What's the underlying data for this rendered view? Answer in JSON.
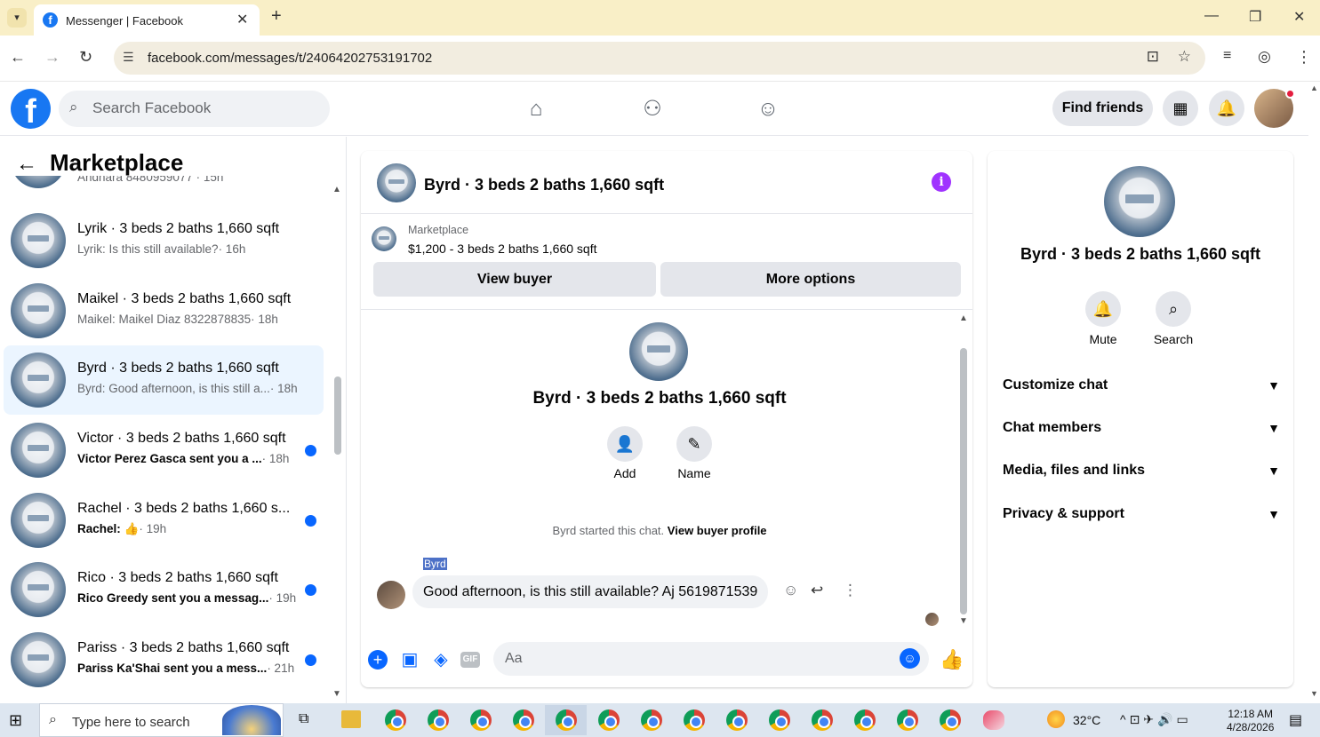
{
  "browser": {
    "tab_title": "Messenger | Facebook",
    "url": "facebook.com/messages/t/24064202753191702",
    "tab_close": "✕",
    "new_tab": "+",
    "window_controls": [
      "—",
      "❐",
      "✕"
    ]
  },
  "header": {
    "logo": "f",
    "search_placeholder": "Search Facebook",
    "find_friends": "Find friends",
    "nav_icons": [
      "home-icon",
      "friends-icon",
      "groups-icon"
    ],
    "right_icons": [
      "menu-grid-icon",
      "bell-icon",
      "avatar"
    ]
  },
  "sidebar": {
    "title": "Marketplace",
    "partial_top": "Andhara 8480959077 · 15h",
    "conversations": [
      {
        "name": "Lyrik · 3 beds 2 baths 1,660 sqft",
        "preview": "Lyrik: Is this still available?",
        "time": "· 16h",
        "unread": false,
        "selected": false
      },
      {
        "name": "Maikel · 3 beds 2 baths 1,660 sqft",
        "preview": "Maikel: Maikel Diaz 8322878835",
        "time": "· 18h",
        "unread": false,
        "selected": false
      },
      {
        "name": "Byrd · 3 beds 2 baths 1,660 sqft",
        "preview": "Byrd: Good afternoon, is this still a...",
        "time": "· 18h",
        "unread": false,
        "selected": true
      },
      {
        "name": "Victor · 3 beds 2 baths 1,660 sqft",
        "preview": "Victor Perez Gasca sent you a ...",
        "time": "· 18h",
        "unread": true,
        "selected": false
      },
      {
        "name": "Rachel · 3 beds 2 baths 1,660 s...",
        "preview": "Rachel: 👍",
        "time": "· 19h",
        "unread": true,
        "selected": false
      },
      {
        "name": "Rico · 3 beds 2 baths 1,660 sqft",
        "preview": "Rico Greedy sent you a messag...",
        "time": "· 19h",
        "unread": true,
        "selected": false
      },
      {
        "name": "Pariss · 3 beds 2 baths 1,660 sqft",
        "preview": "Pariss Ka'Shai sent you a mess...",
        "time": "· 21h",
        "unread": true,
        "selected": false
      }
    ]
  },
  "chat": {
    "title": "Byrd · 3 beds 2 baths 1,660 sqft",
    "listing_source": "Marketplace",
    "listing_title": "$1,200 - 3 beds 2 baths 1,660 sqft",
    "view_buyer": "View buyer",
    "more_options": "More options",
    "intro_title": "Byrd · 3 beds 2 baths 1,660 sqft",
    "add_label": "Add",
    "name_label": "Name",
    "started_text": "Byrd started this chat.",
    "view_buyer_profile": "View buyer profile",
    "sender": "Byrd",
    "message": "Good afternoon, is this still available? Aj 5619871539",
    "composer_placeholder": "Aa"
  },
  "details": {
    "title": "Byrd · 3 beds 2 baths 1,660 sqft",
    "mute": "Mute",
    "search": "Search",
    "sections": [
      "Customize chat",
      "Chat members",
      "Media, files and links",
      "Privacy & support"
    ]
  },
  "taskbar": {
    "search_placeholder": "Type here to search",
    "temperature": "32°C",
    "time": "12:18 AM",
    "date": "4/28/2026"
  },
  "colors": {
    "brand": "#1877f2",
    "messenger_blue": "#0866ff",
    "info_purple": "#a033ff",
    "selected_bg": "#ebf5ff",
    "tab_bar": "#f9efc7"
  }
}
